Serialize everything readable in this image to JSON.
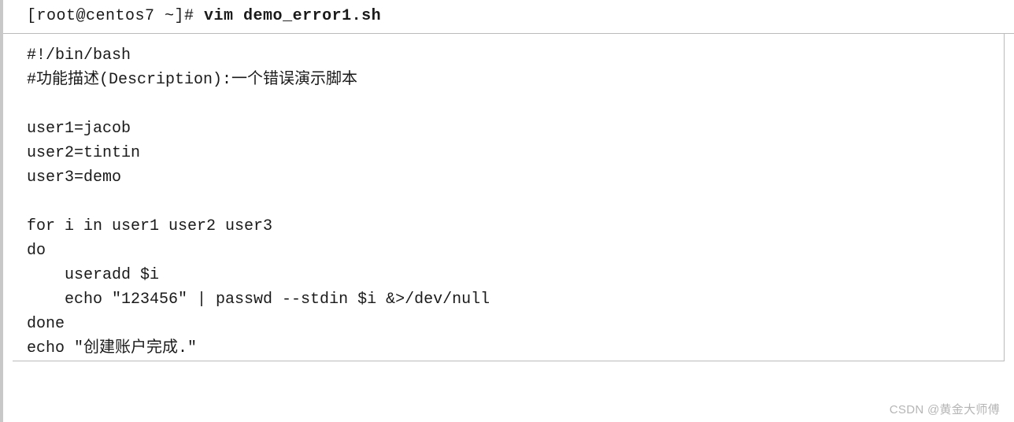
{
  "command": {
    "prompt": "[root@centos7 ~]# ",
    "cmd": "vim demo_error1.sh"
  },
  "script": {
    "lines": [
      "#!/bin/bash",
      "#功能描述(Description):一个错误演示脚本",
      "",
      "user1=jacob",
      "user2=tintin",
      "user3=demo",
      "",
      "for i in user1 user2 user3",
      "do",
      "    useradd $i",
      "    echo \"123456\" | passwd --stdin $i &>/dev/null",
      "done",
      "echo \"创建账户完成.\""
    ]
  },
  "watermark": "CSDN @黄金大师傅"
}
